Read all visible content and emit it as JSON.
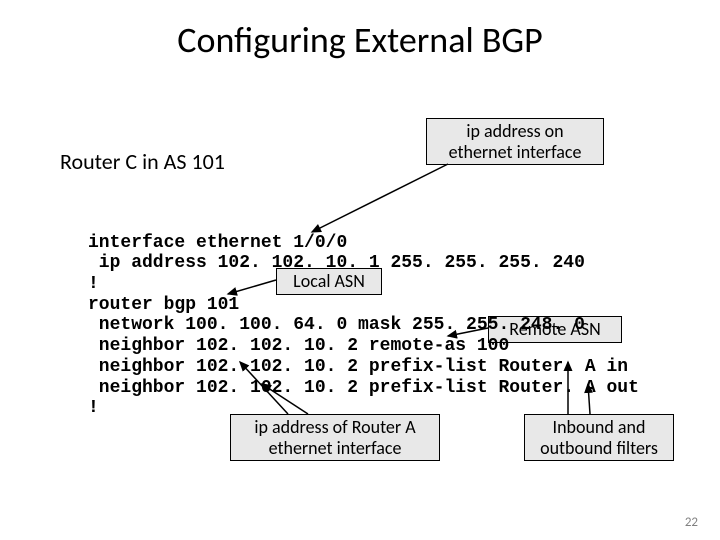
{
  "title": "Configuring External BGP",
  "router_label": "Router C in AS 101",
  "callouts": {
    "ip_addr_eth": "ip address on\nethernet interface",
    "local_asn": "Local ASN",
    "remote_asn": "Remote ASN",
    "router_a_ip": "ip address of Router A ethernet interface",
    "filters": "Inbound and outbound filters"
  },
  "config": {
    "l1": "interface ethernet 1/0/0",
    "l2": " ip address 102. 102. 10. 1 255. 255. 255. 240",
    "l3": "!",
    "l4": "router bgp 101",
    "l5": " network 100. 100. 64. 0 mask 255. 255. 248. 0",
    "l6": " neighbor 102. 102. 10. 2 remote-as 100",
    "l7": " neighbor 102. 102. 10. 2 prefix-list Router. A in",
    "l8": " neighbor 102. 102. 10. 2 prefix-list Router. A out",
    "l9": "!"
  },
  "page_number": "22"
}
